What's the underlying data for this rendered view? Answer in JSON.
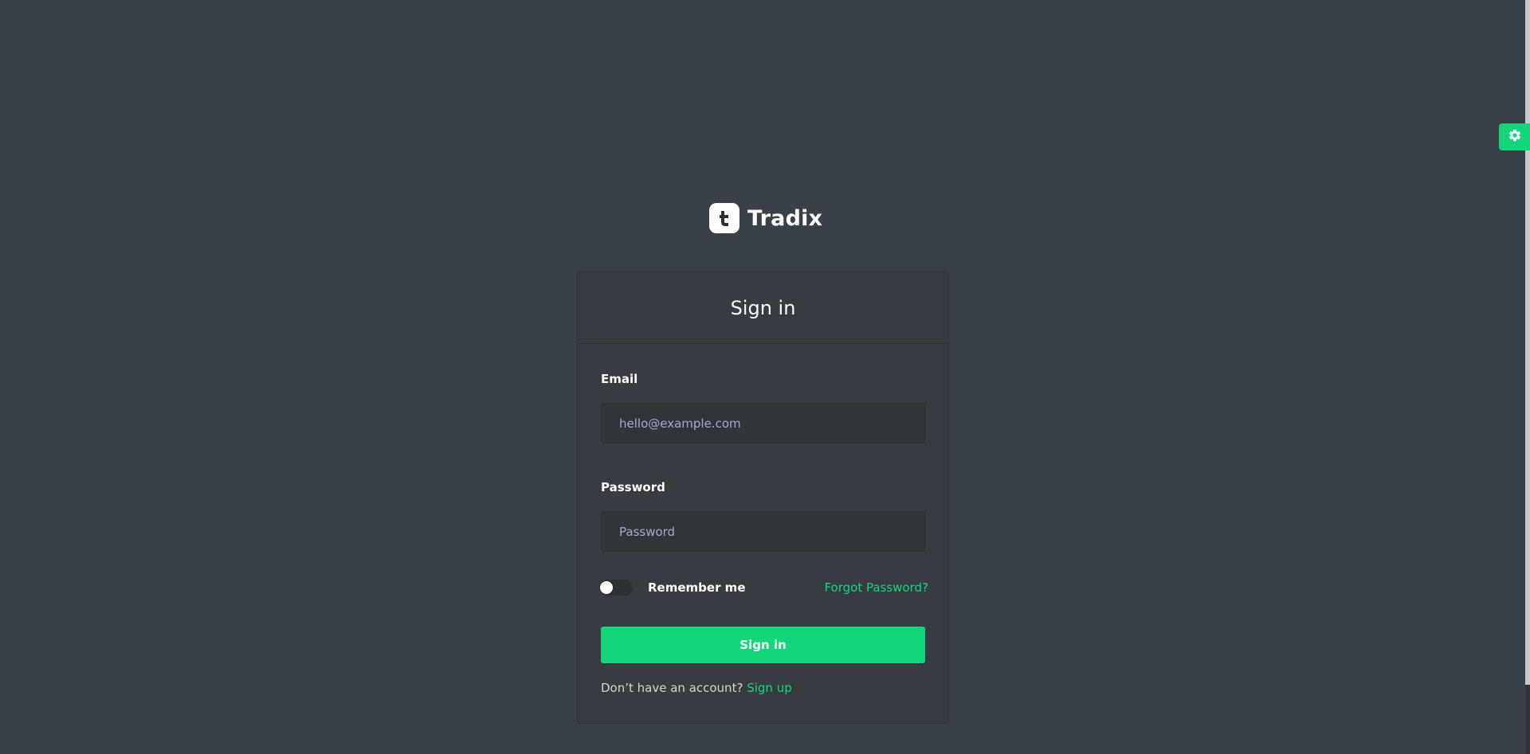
{
  "brand": {
    "name": "Tradix",
    "logo_glyph": "t",
    "accent_color": "#13d67a",
    "background_color": "#394047"
  },
  "settings_fab": {
    "icon": "gear-icon"
  },
  "signin_card": {
    "title": "Sign in",
    "email": {
      "label": "Email",
      "value": "",
      "placeholder": "hello@example.com"
    },
    "password": {
      "label": "Password",
      "value": "",
      "placeholder": "Password"
    },
    "remember_me": {
      "label": "Remember me",
      "checked": false
    },
    "forgot_password_label": "Forgot Password?",
    "submit_label": "Sign in",
    "signup_prompt": "Don’t have an account?",
    "signup_link_label": "Sign up"
  }
}
